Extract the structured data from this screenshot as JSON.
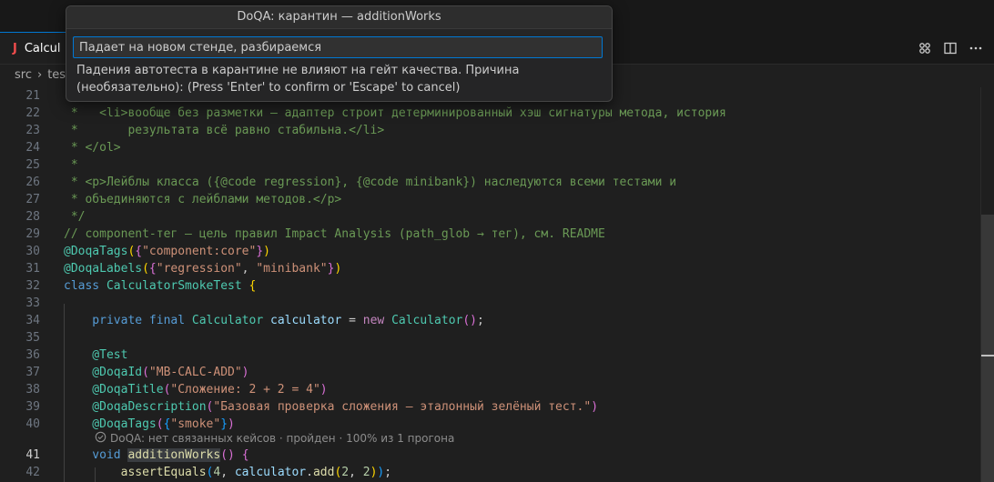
{
  "tab": {
    "icon_text": "J",
    "label": "Calcul"
  },
  "breadcrumbs": [
    "src",
    "test"
  ],
  "dialog": {
    "title": "DoQA: карантин — additionWorks",
    "input_value": "Падает на новом стенде, разбираемся",
    "message": "Падения автотеста в карантине не влияют на гейт качества. Причина (необязательно): (Press 'Enter' to confirm or 'Escape' to cancel)"
  },
  "code_lens": {
    "icon": "check-circle-icon",
    "text": "DoQA: нет связанных кейсов · пройден · 100% из 1 прогона"
  },
  "editor": {
    "active_line": "41",
    "line_numbers": [
      "21",
      "22",
      "23",
      "24",
      "25",
      "26",
      "27",
      "28",
      "29",
      "30",
      "31",
      "32",
      "33",
      "34",
      "35",
      "36",
      "37",
      "38",
      "39",
      "40",
      "41",
      "42"
    ],
    "code": {
      "l22a": " *   <li>вообще без разметки — адаптер строит детерминированный хэш сигнатуры метода, история",
      "l23a": " *       результата всё равно стабильна.</li>",
      "l24a": " * </ol>",
      "l25a": " *",
      "l26a": " * <p>Лейблы класса ({@code regression}, {@code minibank}) наследуются всеми тестами и",
      "l27a": " * объединяются с лейблами методов.</p>",
      "l28a": " */",
      "l29a": "// component-тег — цель правил Impact Analysis (path_glob → тег), см. README",
      "l30a": "@DoqaTags",
      "l30b": "(",
      "l30c": "{",
      "l30d": "\"component:core\"",
      "l30e": "}",
      "l30f": ")",
      "l31a": "@DoqaLabels",
      "l31b": "(",
      "l31c": "{",
      "l31d": "\"regression\"",
      "l31e": ", ",
      "l31f": "\"minibank\"",
      "l31g": "}",
      "l31h": ")",
      "l32a": "class ",
      "l32b": "CalculatorSmokeTest",
      "l32c": " ",
      "l32d": "{",
      "l34a": "    private final ",
      "l34b": "Calculator",
      "l34c": " ",
      "l34d": "calculator",
      "l34e": " = ",
      "l34f": "new ",
      "l34g": "Calculator",
      "l34h": "()",
      "l34i": ";",
      "l36a": "    @Test",
      "l37a": "    @DoqaId",
      "l37b": "(",
      "l37c": "\"MB-CALC-ADD\"",
      "l37d": ")",
      "l38a": "    @DoqaTitle",
      "l38b": "(",
      "l38c": "\"Сложение: 2 + 2 = 4\"",
      "l38d": ")",
      "l39a": "    @DoqaDescription",
      "l39b": "(",
      "l39c": "\"Базовая проверка сложения — эталонный зелёный тест.\"",
      "l39d": ")",
      "l40a": "    @DoqaTags",
      "l40b": "(",
      "l40c": "{",
      "l40d": "\"smoke\"",
      "l40e": "}",
      "l40f": ")",
      "l41a": "    void ",
      "l41b": "additionWorks",
      "l41c": "()",
      "l41d": " ",
      "l41e": "{",
      "l42a": "        assertEquals",
      "l42b": "(",
      "l42c": "4",
      "l42d": ", ",
      "l42e": "calculator",
      "l42f": ".",
      "l42g": "add",
      "l42h": "(",
      "l42i": "2",
      "l42j": ", ",
      "l42k": "2",
      "l42l": ")",
      "l42m": ")",
      "l42n": ";"
    }
  }
}
